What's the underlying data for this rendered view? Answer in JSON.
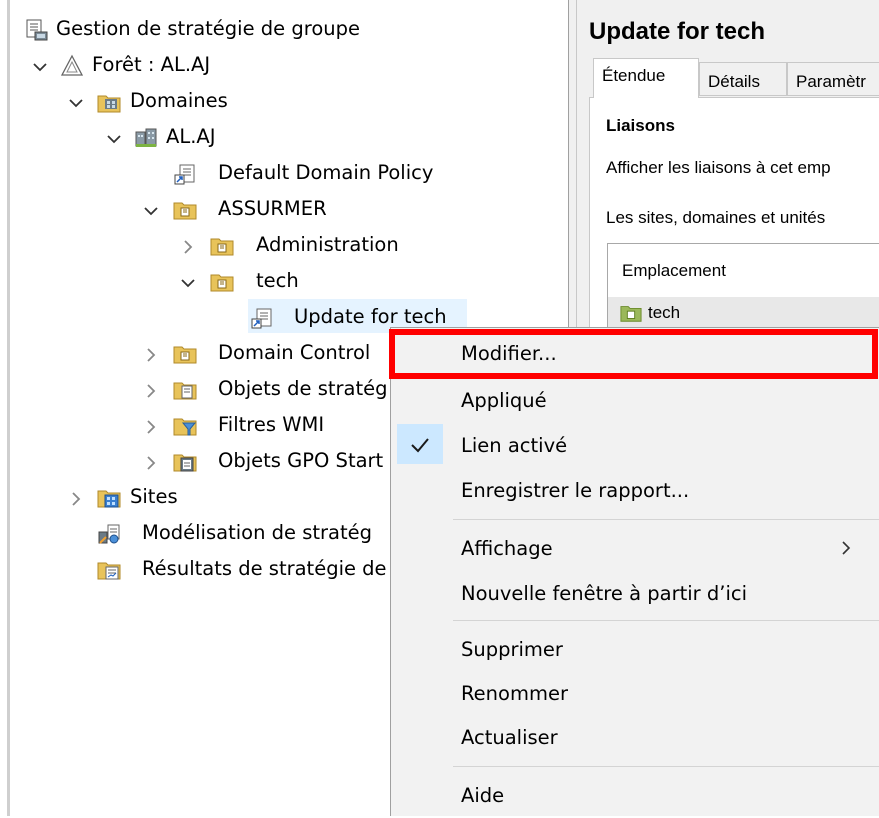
{
  "tree": {
    "root": {
      "label": "Gestion de stratégie de groupe"
    },
    "forest": {
      "label": "Forêt : AL.AJ"
    },
    "domains": {
      "label": "Domaines"
    },
    "domain": {
      "label": "AL.AJ"
    },
    "default_policy": {
      "label": "Default Domain Policy"
    },
    "assurmer": {
      "label": "ASSURMER"
    },
    "administration": {
      "label": "Administration"
    },
    "tech": {
      "label": "tech"
    },
    "update_for_tech": {
      "label": "Update for tech"
    },
    "domain_controllers": {
      "label": "Domain Control"
    },
    "gpo_objects": {
      "label": "Objets de stratég"
    },
    "wmi_filters": {
      "label": "Filtres WMI"
    },
    "starter_gpo": {
      "label": "Objets GPO Start"
    },
    "sites": {
      "label": "Sites"
    },
    "modeling": {
      "label": "Modélisation de stratég"
    },
    "results": {
      "label": "Résultats de stratégie de"
    }
  },
  "details": {
    "title": "Update for tech",
    "tabs": [
      {
        "label": "Étendue"
      },
      {
        "label": "Détails"
      },
      {
        "label": "Paramètr"
      }
    ],
    "section_title": "Liaisons",
    "links_text": "Afficher les liaisons à cet emp",
    "sites_text": "Les sites, domaines et unités",
    "column_header": "Emplacement",
    "row_value": "tech"
  },
  "context_menu": {
    "items": [
      {
        "label": "Modifier..."
      },
      {
        "label": "Appliqué"
      },
      {
        "label": "Lien activé",
        "checked": true
      },
      {
        "label": "Enregistrer le rapport..."
      },
      {
        "label": "Affichage",
        "submenu": true
      },
      {
        "label": "Nouvelle fenêtre à partir d’ici"
      },
      {
        "label": "Supprimer"
      },
      {
        "label": "Renommer"
      },
      {
        "label": "Actualiser"
      },
      {
        "label": "Aide"
      }
    ]
  },
  "colors": {
    "highlight_box": "#ff0000",
    "folder_yellow": "#e8c35a",
    "check_blue": "#cce8ff",
    "selection": "#e5f3ff"
  },
  "icons": {
    "chevron_expanded": "chevron-down-icon",
    "chevron_collapsed": "chevron-right-icon",
    "folder": "ou-folder-icon",
    "gpo": "gpo-scroll-icon",
    "check": "check-icon",
    "submenu": "submenu-arrow-icon"
  }
}
